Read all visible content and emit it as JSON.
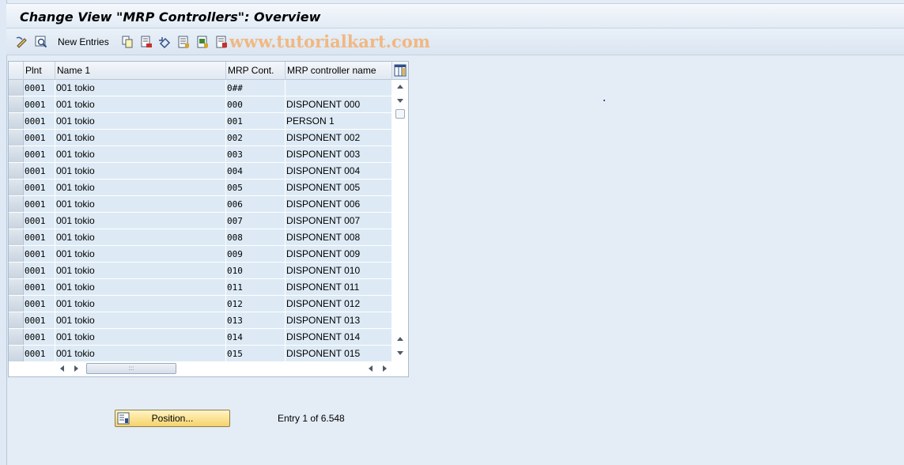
{
  "window": {
    "title": "Change View \"MRP Controllers\": Overview"
  },
  "toolbar": {
    "new_entries_label": "New Entries",
    "watermark": "www.tutorialkart.com",
    "icons": [
      "display-change-icon",
      "find-icon",
      "copy-icon",
      "delete-icon",
      "undo-icon",
      "select-all-icon",
      "select-block-icon",
      "deselect-all-icon",
      "print-icon"
    ]
  },
  "table": {
    "columns": [
      "Plnt",
      "Name 1",
      "MRP Cont.",
      "MRP controller name"
    ],
    "rows": [
      {
        "plnt": "0001",
        "name1": "001 tokio",
        "mrp_cont": "0##",
        "controller_name": ""
      },
      {
        "plnt": "0001",
        "name1": "001 tokio",
        "mrp_cont": "000",
        "controller_name": "DISPONENT 000"
      },
      {
        "plnt": "0001",
        "name1": "001 tokio",
        "mrp_cont": "001",
        "controller_name": "PERSON 1"
      },
      {
        "plnt": "0001",
        "name1": "001 tokio",
        "mrp_cont": "002",
        "controller_name": "DISPONENT 002"
      },
      {
        "plnt": "0001",
        "name1": "001 tokio",
        "mrp_cont": "003",
        "controller_name": "DISPONENT 003"
      },
      {
        "plnt": "0001",
        "name1": "001 tokio",
        "mrp_cont": "004",
        "controller_name": "DISPONENT 004"
      },
      {
        "plnt": "0001",
        "name1": "001 tokio",
        "mrp_cont": "005",
        "controller_name": "DISPONENT 005"
      },
      {
        "plnt": "0001",
        "name1": "001 tokio",
        "mrp_cont": "006",
        "controller_name": "DISPONENT 006"
      },
      {
        "plnt": "0001",
        "name1": "001 tokio",
        "mrp_cont": "007",
        "controller_name": "DISPONENT 007"
      },
      {
        "plnt": "0001",
        "name1": "001 tokio",
        "mrp_cont": "008",
        "controller_name": "DISPONENT 008"
      },
      {
        "plnt": "0001",
        "name1": "001 tokio",
        "mrp_cont": "009",
        "controller_name": "DISPONENT 009"
      },
      {
        "plnt": "0001",
        "name1": "001 tokio",
        "mrp_cont": "010",
        "controller_name": "DISPONENT 010"
      },
      {
        "plnt": "0001",
        "name1": "001 tokio",
        "mrp_cont": "011",
        "controller_name": "DISPONENT 011"
      },
      {
        "plnt": "0001",
        "name1": "001 tokio",
        "mrp_cont": "012",
        "controller_name": "DISPONENT 012"
      },
      {
        "plnt": "0001",
        "name1": "001 tokio",
        "mrp_cont": "013",
        "controller_name": "DISPONENT 013"
      },
      {
        "plnt": "0001",
        "name1": "001 tokio",
        "mrp_cont": "014",
        "controller_name": "DISPONENT 014"
      },
      {
        "plnt": "0001",
        "name1": "001 tokio",
        "mrp_cont": "015",
        "controller_name": "DISPONENT 015"
      }
    ]
  },
  "footer": {
    "position_label": "Position...",
    "entry_text": "Entry 1 of 6.548"
  }
}
